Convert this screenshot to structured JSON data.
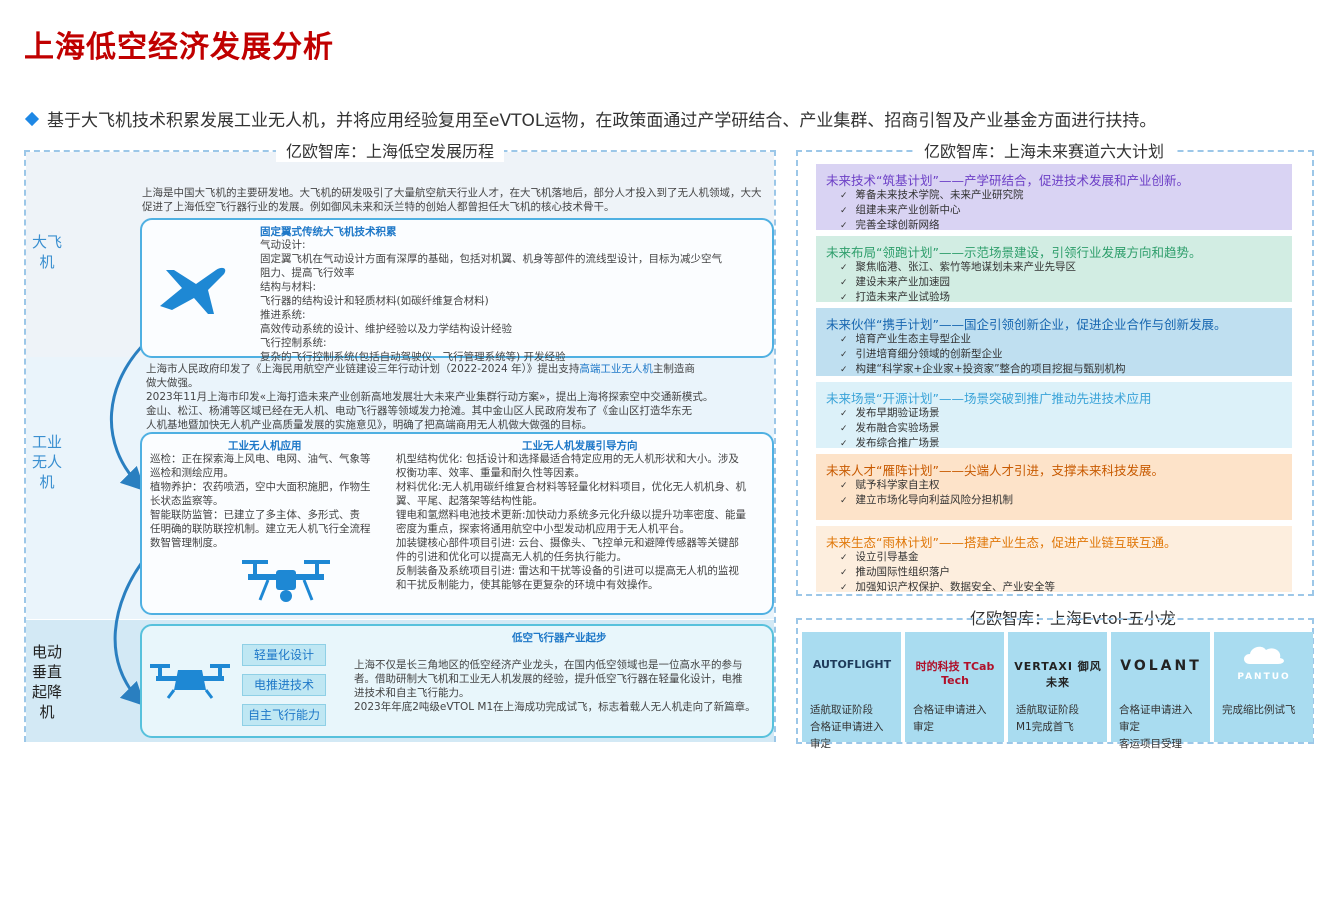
{
  "title": "上海低空经济发展分析",
  "subtitle": "基于大飞机技术积累发展工业无人机，并将应用经验复用至eVTOL运物，在政策面通过产学研结合、产业集群、招商引智及产业基金方面进行扶持。",
  "left_panel": {
    "title": "亿欧智库：上海低空发展历程",
    "band1": {
      "label": "大飞机",
      "intro": "上海是中国大飞机的主要研发地。大飞机的研发吸引了大量航空航天行业人才，在大飞机落地后，部分人才投入到了无人机领域，大大促进了上海低空飞行器行业的发展。例如御风未来和沃兰特的创始人都曾担任大飞机的核心技术骨干。",
      "card_title": "固定翼式传统大飞机技术积累",
      "card_lines": [
        "气动设计:",
        "固定翼飞机在气动设计方面有深厚的基础，包括对机翼、机身等部件的流线型设计，目标为减少空气",
        "阻力、提高飞行效率",
        "结构与材料:",
        "飞行器的结构设计和轻质材料(如碳纤维复合材料)",
        "推进系统:",
        "高效传动系统的设计、维护经验以及力学结构设计经验",
        "飞行控制系统:",
        "复杂的飞行控制系统(包括自动驾驶仪、飞行管理系统等) 开发经验"
      ]
    },
    "band2": {
      "label": "工业无人机",
      "p1_pre": "上海市人民政府印发了《上海民用航空产业链建设三年行动计划（2022-2024 年）》提出支持",
      "p1_hl": "高端工业无人机",
      "p1_post": "主制造商",
      "p1_line2": "做大做强。",
      "p2": [
        "2023年11月上海市印发«上海打造未来产业创新高地发展壮大未来产业集群行动方案»，提出上海将探索空中交通新模式。",
        "金山、松江、杨浦等区域已经在无人机、电动飞行器等领域发力抢滩。其中金山区人民政府发布了《金山区打造华东无",
        "人机基地暨加快无人机产业高质量发展的实施意见》，明确了把高端商用无人机做大做强的目标。"
      ],
      "app_title": "工业无人机应用",
      "app_lines": [
        "巡检：正在探索海上风电、电网、油气、气象等",
        "巡检和测绘应用。",
        "植物养护：农药喷洒，空中大面积施肥，作物生",
        "长状态监察等。",
        "智能联防监管：已建立了多主体、多形式、责",
        "任明确的联防联控机制。建立无人机飞行全流程",
        "数智管理制度。"
      ],
      "dir_title": "工业无人机发展引导方向",
      "dir_lines": [
        "机型结构优化: 包括设计和选择最适合特定应用的无人机形状和大小。涉及",
        "权衡功率、效率、重量和耐久性等因素。",
        "材料优化:无人机用碳纤维复合材料等轻量化材料项目，优化无人机机身、机",
        "翼、平尾、起落架等结构性能。",
        "锂电和氢燃料电池技术更新:加快动力系统多元化升级以提升功率密度、能量",
        "密度为重点，探索将通用航空中小型发动机应用于无人机平台。",
        "加装键核心部件项目引进: 云台、摄像头、飞控单元和避障传感器等关键部",
        "件的引进和优化可以提高无人机的任务执行能力。",
        "反制装备及系统项目引进: 雷达和干扰等设备的引进可以提高无人机的监视",
        "和干扰反制能力，使其能够在更复杂的环境中有效操作。"
      ]
    },
    "band3": {
      "label": "电动垂直起降机",
      "card_title": "低空飞行器产业起步",
      "badges": [
        "轻量化设计",
        "电推进技术",
        "自主飞行能力"
      ],
      "lines": [
        "上海不仅是长三角地区的低空经济产业龙头，在国内低空领域也是一位高水平的参与",
        "者。借助研制大飞机和工业无人机发展的经验，提升低空飞行器在轻量化设计，电推",
        "进技术和自主飞行能力。",
        "2023年年底2吨级eVTOL M1在上海成功完成试飞，标志着载人无人机走向了新篇章。"
      ]
    }
  },
  "right_panel": {
    "title": "亿欧智库：上海未来赛道六大计划",
    "plans": [
      {
        "head": "未来技术“筑基计划”——产学研结合，促进技术发展和产业创新。",
        "color": "#6c3fc6",
        "bg": "#d9d3f3",
        "items": [
          "筹备未来技术学院、未来产业研究院",
          "组建未来产业创新中心",
          "完善全球创新网络"
        ]
      },
      {
        "head": "未来布局“领跑计划”——示范场景建设，引领行业发展方向和趋势。",
        "color": "#2e9e6b",
        "bg": "#d2ede3",
        "items": [
          "聚焦临港、张江、紫竹等地谋划未来产业先导区",
          "建设未来产业加速园",
          "打造未来产业试验场"
        ]
      },
      {
        "head": "未来伙伴“携手计划”——国企引领创新企业，促进企业合作与创新发展。",
        "color": "#1766b0",
        "bg": "#bfdff0",
        "items": [
          "培育产业生态主导型企业",
          "引进培育细分领域的创新型企业",
          "构建“科学家+企业家+投资家”整合的项目挖掘与甄别机构"
        ]
      },
      {
        "head": "未来场景“开源计划”——场景突破到推广推动先进技术应用",
        "color": "#3aa3d8",
        "bg": "#dcf1f9",
        "items": [
          "发布早期验证场景",
          "发布融合实验场景",
          "发布综合推广场景"
        ]
      },
      {
        "head": "未来人才“雁阵计划”——尖端人才引进，支撑未来科技发展。",
        "color": "#c85a00",
        "bg": "#fde3c9",
        "items": [
          "赋予科学家自主权",
          "建立市场化导向利益风险分担机制"
        ]
      },
      {
        "head": "未来生态“雨林计划”——搭建产业生态，促进产业链互联互通。",
        "color": "#e0780a",
        "bg": "#fdeede",
        "items": [
          "设立引导基金",
          "推动国际性组织落户",
          "加强知识产权保护、数据安全、产业安全等"
        ]
      }
    ]
  },
  "dragons": {
    "title": "亿欧智库：上海Evtol-五小龙",
    "items": [
      {
        "logo": "AUTOFLIGHT",
        "lines": [
          "适航取证阶段",
          "合格证申请进入",
          "审定"
        ]
      },
      {
        "logo": "时的科技 TCab Tech",
        "lines": [
          "合格证申请进入",
          "审定"
        ]
      },
      {
        "logo": "VERTAXI 御风未来",
        "lines": [
          "适航取证阶段",
          "M1完成首飞"
        ]
      },
      {
        "logo": "VOLANT",
        "lines": [
          "合格证申请进入",
          "审定",
          "客运项目受理"
        ]
      },
      {
        "logo": "PANTUO",
        "lines": [
          "完成缩比例试飞"
        ]
      }
    ]
  }
}
